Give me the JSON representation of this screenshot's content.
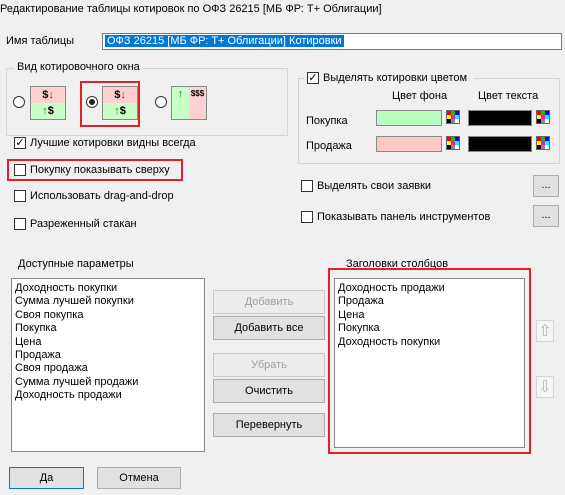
{
  "window": {
    "title": "Редактирование таблицы котировок по ОФЗ 26215 [МБ ФР: Т+ Облигации]"
  },
  "table_name": {
    "label": "Имя таблицы",
    "value": "ОФЗ 26215 [МБ ФР: Т+ Облигации] Котировки"
  },
  "view_group": {
    "title": "Вид котировочного окна"
  },
  "icons": {
    "dollar": "$",
    "up": "↑",
    "down": "↓",
    "stack": "$$$"
  },
  "options": {
    "best_quotes_always": "Лучшие котировки видны всегда",
    "buy_on_top": "Покупку показывать сверху",
    "drag_and_drop": "Использовать drag-and-drop",
    "sparse_book": "Разреженный стакан",
    "highlight_own": "Выделять свои заявки",
    "show_toolbar": "Показывать панель инструментов",
    "ellipsis": "..."
  },
  "color_group": {
    "title": "Выделять котировки цветом",
    "bg_header": "Цвет фона",
    "text_header": "Цвет текста",
    "row_buy": "Покупка",
    "row_sell": "Продажа",
    "buy_bg": "#b9ffbf",
    "sell_bg": "#ffc8c8",
    "text_color": "#000000"
  },
  "available": {
    "title": "Доступные параметры",
    "items": [
      "Доходность покупки",
      "Сумма лучшей покупки",
      "Своя покупка",
      "Покупка",
      "Цена",
      "Продажа",
      "Своя продажа",
      "Сумма лучшей продажи",
      "Доходность продажи"
    ]
  },
  "columns": {
    "title": "Заголовки столбцов",
    "items": [
      "Доходность продажи",
      "Продажа",
      "Цена",
      "Покупка",
      "Доходность покупки"
    ]
  },
  "actions": {
    "add": "Добавить",
    "add_all": "Добавить все",
    "remove": "Убрать",
    "clear": "Очистить",
    "reverse": "Перевернуть"
  },
  "move": {
    "up": "⇧",
    "down": "⇩"
  },
  "footer": {
    "ok": "Да",
    "cancel": "Отмена"
  }
}
